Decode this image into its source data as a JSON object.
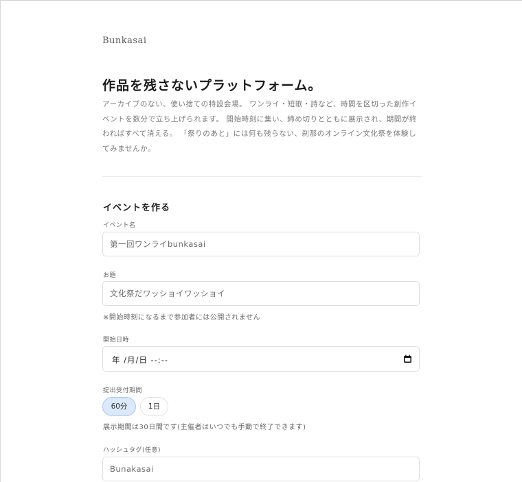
{
  "brand": "Bunkasai",
  "hero": {
    "title": "作品を残さないプラットフォーム。",
    "description": "アーカイブのない、使い捨ての特設会場。 ワンライ・短歌・詩など、時間を区切った創作イベントを数分で立ち上げられます。 開始時刻に集い、締め切りとともに展示され、期間が終わればすべて消える。 「祭りのあと」には何も残らない、刹那のオンライン文化祭を体験してみませんか。"
  },
  "form": {
    "section_title": "イベントを作る",
    "event_name": {
      "label": "イベント名",
      "placeholder": "第一回ワンライbunkasai"
    },
    "topic": {
      "label": "お題",
      "placeholder": "文化祭だワッショイワッショイ",
      "note": "※開始時刻になるまで参加者には公開されません"
    },
    "start_datetime": {
      "label": "開始日時",
      "value": "年 /月/日 --:--",
      "icon": "calendar-icon"
    },
    "submission_period": {
      "label": "提出受付期間",
      "options": [
        {
          "label": "60分",
          "selected": true
        },
        {
          "label": "1日",
          "selected": false
        }
      ],
      "note": "展示期間は30日間です(主催者はいつでも手動で終了できます)"
    },
    "hashtag": {
      "label": "ハッシュタグ(任意)",
      "placeholder": "Bunakasai"
    }
  },
  "colors": {
    "accent_fill": "#dbe9fb",
    "accent_border": "#a9c8f0",
    "input_border": "#dedede"
  }
}
